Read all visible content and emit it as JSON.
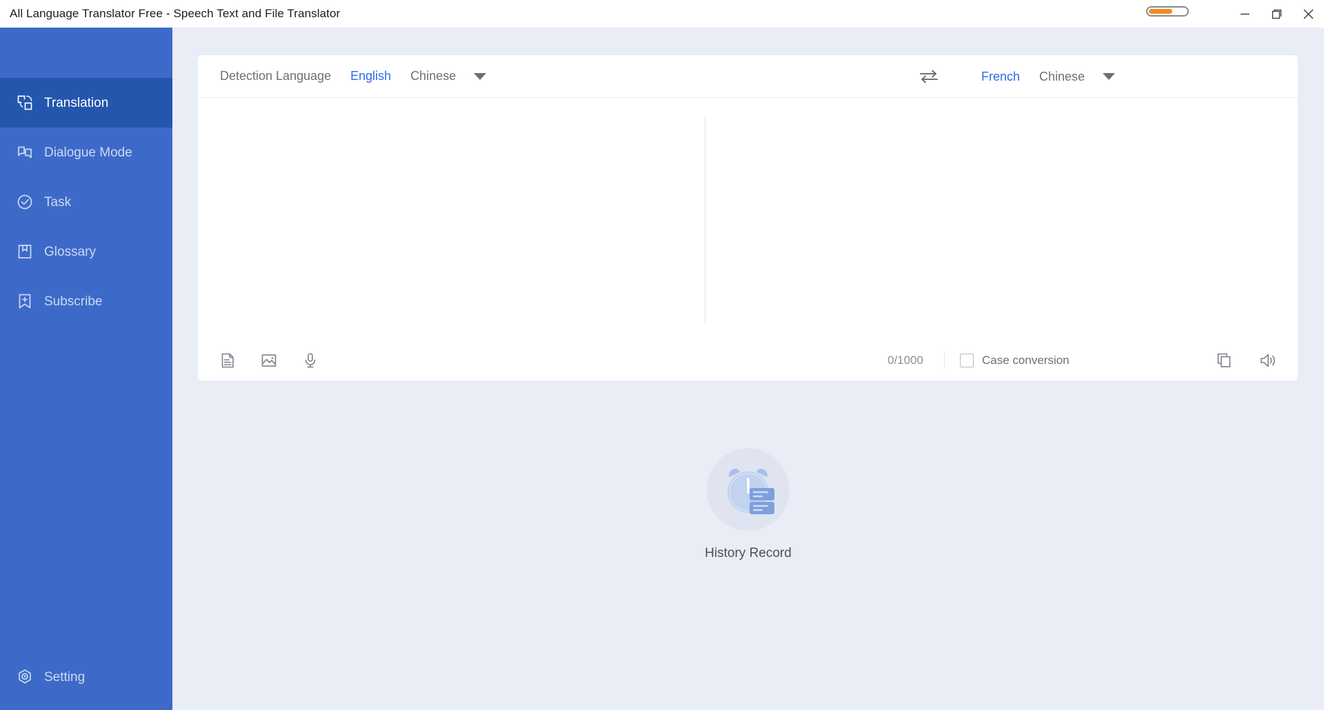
{
  "window": {
    "title": "All Language Translator Free - Speech Text and File Translator",
    "controls": {
      "minimize": "minimize-button",
      "maximize": "maximize-button",
      "close": "close-button",
      "progress_percent": 55
    }
  },
  "sidebar": {
    "accent_color": "#3d6ac9",
    "active_color": "#2456ad",
    "items": [
      {
        "label": "Translation",
        "icon": "translation-icon",
        "active": true
      },
      {
        "label": "Dialogue Mode",
        "icon": "dialogue-icon",
        "active": false
      },
      {
        "label": "Task",
        "icon": "task-check-icon",
        "active": false
      },
      {
        "label": "Glossary",
        "icon": "glossary-book-icon",
        "active": false
      },
      {
        "label": "Subscribe",
        "icon": "subscribe-bookmark-icon",
        "active": false
      }
    ],
    "setting": {
      "label": "Setting",
      "icon": "gear-icon"
    }
  },
  "translator": {
    "source": {
      "detect_label": "Detection Language",
      "languages": [
        {
          "label": "English",
          "active": true
        },
        {
          "label": "Chinese",
          "active": false
        }
      ],
      "dropdown_icon": "chevron-down-icon",
      "placeholder": "",
      "value": "",
      "char_count": "0/1000",
      "tools": [
        {
          "name": "document-icon",
          "label": "Document translation"
        },
        {
          "name": "image-icon",
          "label": "Image translation"
        },
        {
          "name": "microphone-icon",
          "label": "Voice input"
        }
      ]
    },
    "swap_icon": "swap-arrows-icon",
    "target": {
      "languages": [
        {
          "label": "French",
          "active": true
        },
        {
          "label": "Chinese",
          "active": false
        }
      ],
      "dropdown_icon": "chevron-down-icon",
      "value": "",
      "tools": [
        {
          "name": "copy-icon",
          "label": "Copy"
        },
        {
          "name": "speaker-icon",
          "label": "Read aloud"
        }
      ]
    },
    "case_conversion": {
      "label": "Case conversion",
      "checked": false
    }
  },
  "history": {
    "label": "History Record",
    "icon": "alarm-clock-history-icon",
    "empty": true
  },
  "colors": {
    "accent_blue": "#2d6bf0",
    "sidebar_blue": "#3d6ac9",
    "sidebar_active": "#2456ad",
    "background": "#e9edf5",
    "card": "#ffffff",
    "orange": "#f28c28"
  }
}
